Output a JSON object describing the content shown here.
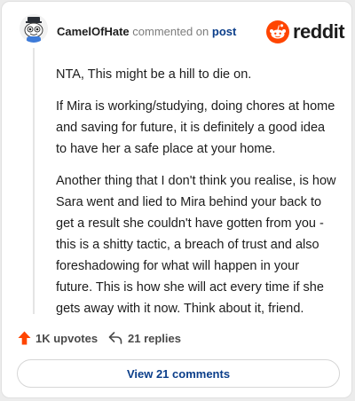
{
  "header": {
    "username": "CamelOfHate",
    "action": "commented on",
    "post_link": "post",
    "avatar_icon": "snoo-avatar-icon",
    "brand_name": "reddit",
    "brand_icon": "reddit-logo-icon",
    "brand_color": "#ff4500"
  },
  "comment": {
    "paragraphs": [
      "NTA, This might be a hill to die on.",
      "If Mira is working/studying, doing chores at home and saving for future, it is definitely a good idea to have her a safe place at your home.",
      "Another thing that I don't think you realise, is how Sara went and lied to Mira behind your back to get a result she couldn't have gotten from you - this is a shitty tactic, a breach of trust and also foreshadowing for what will happen in your future. This is how she will act every time if she gets away with it now. Think about it, friend."
    ]
  },
  "footer": {
    "upvotes": "1K upvotes",
    "upvote_icon": "upvote-arrow-icon",
    "replies": "21 replies",
    "reply_icon": "reply-icon",
    "view_comments": "View 21 comments"
  },
  "colors": {
    "accent": "#ff4500",
    "link": "#0b3e8a"
  }
}
